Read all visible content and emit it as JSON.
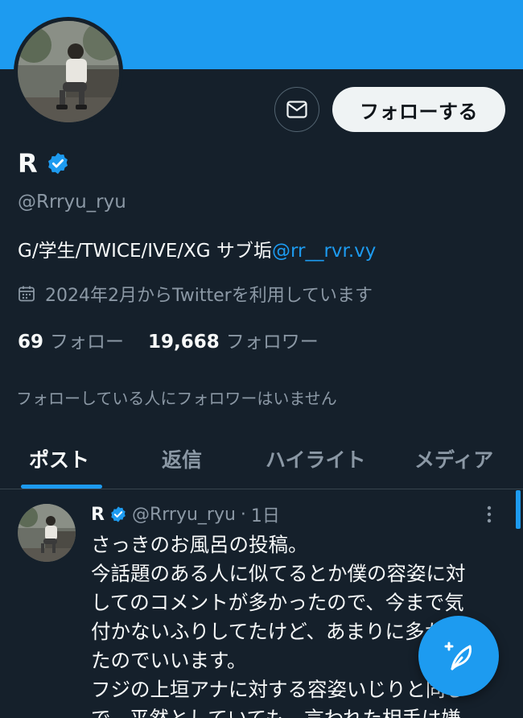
{
  "profile": {
    "display_name": "R",
    "handle": "@Rrryu_ryu",
    "bio_text": "G/学生/TWICE/IVE/XG サブ垢",
    "bio_link": "@rr__rvr.vy",
    "joined": "2024年2月からTwitterを利用しています",
    "following_count": "69",
    "following_label": "フォロー",
    "followers_count": "19,668",
    "followers_label": "フォロワー",
    "no_mutual_followers": "フォローしている人にフォロワーはいません",
    "follow_button": "フォローする"
  },
  "tabs": [
    {
      "label": "ポスト",
      "active": true
    },
    {
      "label": "返信",
      "active": false
    },
    {
      "label": "ハイライト",
      "active": false
    },
    {
      "label": "メディア",
      "active": false
    }
  ],
  "post": {
    "name": "R",
    "handle": "@Rrryu_ryu",
    "separator": "·",
    "time": "1日",
    "lines": [
      "さっきのお風呂の投稿。",
      "今話題のある人に似てるとか僕の容姿に対",
      "してのコメントが多かったので、今まで気",
      "付かないふりしてたけど、あまりに多かっ",
      "たのでいいます。",
      "フジの上垣アナに対する容姿いじりと同じ",
      "で、平然としていても、言われた相手は嫌"
    ]
  },
  "icons": {
    "message": "envelope-icon",
    "verified": "verified-badge-icon",
    "calendar": "calendar-icon",
    "more": "more-vertical-icon",
    "compose": "compose-feather-icon"
  },
  "colors": {
    "accent": "#1d9bf0",
    "background": "#15202b",
    "secondary_text": "#8b98a5"
  }
}
